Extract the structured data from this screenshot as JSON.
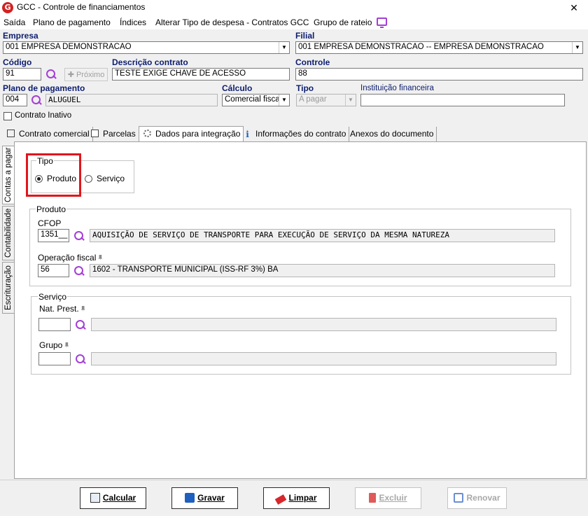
{
  "window": {
    "title": "GCC - Controle de financiamentos",
    "close": "✕"
  },
  "menu": [
    "Saída",
    "Plano de pagamento",
    "Índices",
    "Alterar Tipo de despesa - Contratos GCC",
    "Grupo de rateio"
  ],
  "form": {
    "empresa": {
      "label": "Empresa",
      "value": "001 EMPRESA DEMONSTRACAO"
    },
    "filial": {
      "label": "Filial",
      "value": "001 EMPRESA DEMONSTRACAO -- EMPRESA DEMONSTRACAO"
    },
    "codigo": {
      "label": "Código",
      "value": "91",
      "proximo": "Próximo"
    },
    "descricao": {
      "label": "Descrição contrato",
      "value": "TESTE EXIGE CHAVE DE ACESSO"
    },
    "controle": {
      "label": "Controle",
      "value": "88"
    },
    "plano": {
      "label": "Plano de pagamento",
      "code": "004",
      "name": "ALUGUEL"
    },
    "calculo": {
      "label": "Cálculo",
      "value": "Comercial fiscal"
    },
    "tipo": {
      "label": "Tipo",
      "value": "A pagar"
    },
    "instituicao": {
      "label": "Instituição financeira",
      "value": ""
    },
    "contrato_inativo": "Contrato Inativo"
  },
  "tabs": [
    "Contrato comercial",
    "Parcelas",
    "Dados para integração",
    "Informações do contrato",
    "Anexos do documento"
  ],
  "side_tabs": [
    "Contas a pagar",
    "Contabilidade",
    "Escrituração"
  ],
  "tipo_group": {
    "label": "Tipo",
    "options": [
      "Produto",
      "Serviço"
    ],
    "selected": "Produto"
  },
  "produto": {
    "label": "Produto",
    "cfop": {
      "label": "CFOP",
      "code": "1351__",
      "desc": "AQUISIÇÃO DE SERVIÇO DE TRANSPORTE PARA EXECUÇÃO DE SERVIÇO DA MESMA NATUREZA"
    },
    "operacao": {
      "label": "Operação fiscal",
      "code": "56",
      "desc": "1602 - TRANSPORTE MUNICIPAL (ISS-RF 3%) BA"
    }
  },
  "servico": {
    "label": "Serviço",
    "nat": {
      "label": "Nat. Prest.",
      "code": "",
      "desc": ""
    },
    "grupo": {
      "label": "Grupo",
      "code": "",
      "desc": ""
    }
  },
  "buttons": {
    "calcular": "Calcular",
    "gravar": "Gravar",
    "limpar": "Limpar",
    "excluir": "Excluir",
    "renovar": "Renovar"
  },
  "colors": {
    "accent": "#a33fd6",
    "label": "#0c1d6e",
    "highlight": "#e0161b"
  }
}
